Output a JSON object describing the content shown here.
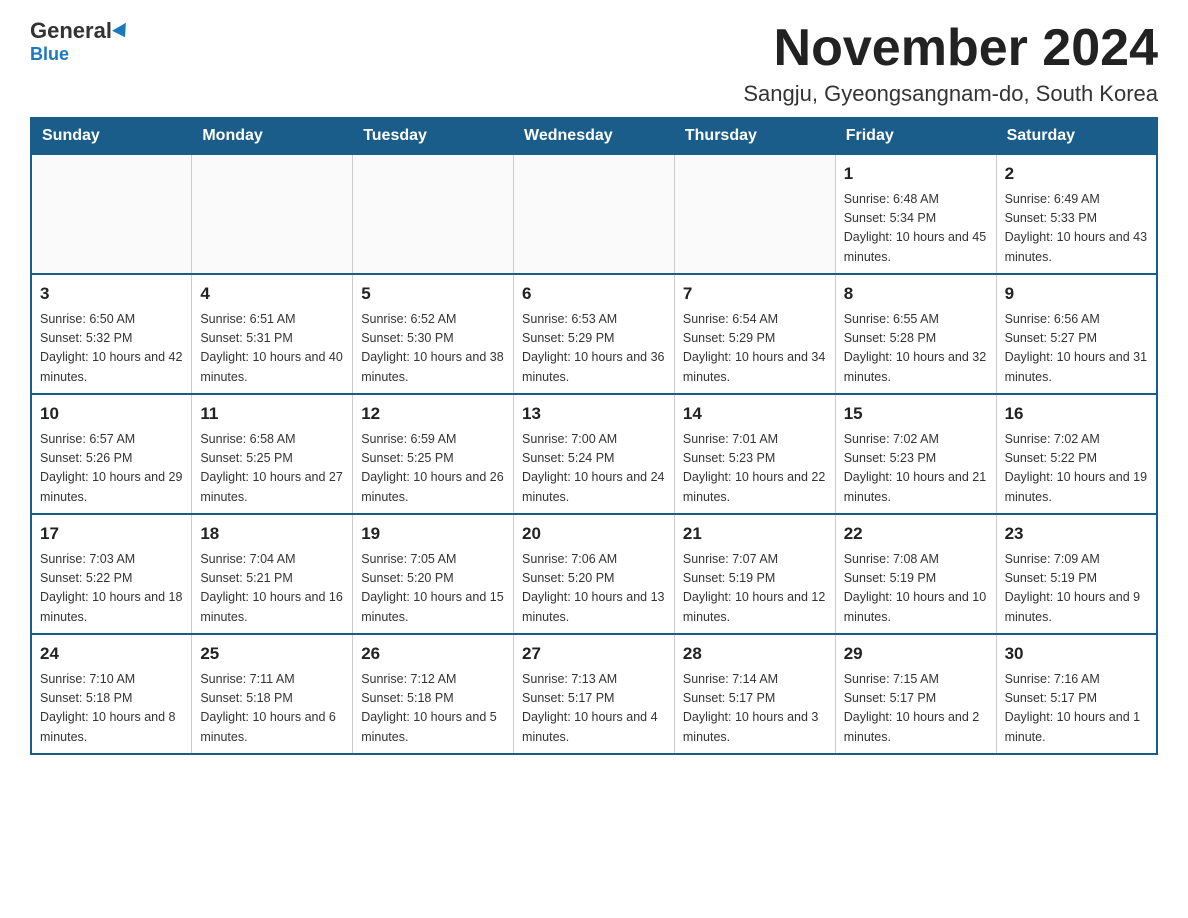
{
  "header": {
    "logo_general": "General",
    "logo_blue": "Blue",
    "month_title": "November 2024",
    "subtitle": "Sangju, Gyeongsangnam-do, South Korea"
  },
  "days_of_week": [
    "Sunday",
    "Monday",
    "Tuesday",
    "Wednesday",
    "Thursday",
    "Friday",
    "Saturday"
  ],
  "weeks": [
    [
      {
        "day": "",
        "info": ""
      },
      {
        "day": "",
        "info": ""
      },
      {
        "day": "",
        "info": ""
      },
      {
        "day": "",
        "info": ""
      },
      {
        "day": "",
        "info": ""
      },
      {
        "day": "1",
        "info": "Sunrise: 6:48 AM\nSunset: 5:34 PM\nDaylight: 10 hours and 45 minutes."
      },
      {
        "day": "2",
        "info": "Sunrise: 6:49 AM\nSunset: 5:33 PM\nDaylight: 10 hours and 43 minutes."
      }
    ],
    [
      {
        "day": "3",
        "info": "Sunrise: 6:50 AM\nSunset: 5:32 PM\nDaylight: 10 hours and 42 minutes."
      },
      {
        "day": "4",
        "info": "Sunrise: 6:51 AM\nSunset: 5:31 PM\nDaylight: 10 hours and 40 minutes."
      },
      {
        "day": "5",
        "info": "Sunrise: 6:52 AM\nSunset: 5:30 PM\nDaylight: 10 hours and 38 minutes."
      },
      {
        "day": "6",
        "info": "Sunrise: 6:53 AM\nSunset: 5:29 PM\nDaylight: 10 hours and 36 minutes."
      },
      {
        "day": "7",
        "info": "Sunrise: 6:54 AM\nSunset: 5:29 PM\nDaylight: 10 hours and 34 minutes."
      },
      {
        "day": "8",
        "info": "Sunrise: 6:55 AM\nSunset: 5:28 PM\nDaylight: 10 hours and 32 minutes."
      },
      {
        "day": "9",
        "info": "Sunrise: 6:56 AM\nSunset: 5:27 PM\nDaylight: 10 hours and 31 minutes."
      }
    ],
    [
      {
        "day": "10",
        "info": "Sunrise: 6:57 AM\nSunset: 5:26 PM\nDaylight: 10 hours and 29 minutes."
      },
      {
        "day": "11",
        "info": "Sunrise: 6:58 AM\nSunset: 5:25 PM\nDaylight: 10 hours and 27 minutes."
      },
      {
        "day": "12",
        "info": "Sunrise: 6:59 AM\nSunset: 5:25 PM\nDaylight: 10 hours and 26 minutes."
      },
      {
        "day": "13",
        "info": "Sunrise: 7:00 AM\nSunset: 5:24 PM\nDaylight: 10 hours and 24 minutes."
      },
      {
        "day": "14",
        "info": "Sunrise: 7:01 AM\nSunset: 5:23 PM\nDaylight: 10 hours and 22 minutes."
      },
      {
        "day": "15",
        "info": "Sunrise: 7:02 AM\nSunset: 5:23 PM\nDaylight: 10 hours and 21 minutes."
      },
      {
        "day": "16",
        "info": "Sunrise: 7:02 AM\nSunset: 5:22 PM\nDaylight: 10 hours and 19 minutes."
      }
    ],
    [
      {
        "day": "17",
        "info": "Sunrise: 7:03 AM\nSunset: 5:22 PM\nDaylight: 10 hours and 18 minutes."
      },
      {
        "day": "18",
        "info": "Sunrise: 7:04 AM\nSunset: 5:21 PM\nDaylight: 10 hours and 16 minutes."
      },
      {
        "day": "19",
        "info": "Sunrise: 7:05 AM\nSunset: 5:20 PM\nDaylight: 10 hours and 15 minutes."
      },
      {
        "day": "20",
        "info": "Sunrise: 7:06 AM\nSunset: 5:20 PM\nDaylight: 10 hours and 13 minutes."
      },
      {
        "day": "21",
        "info": "Sunrise: 7:07 AM\nSunset: 5:19 PM\nDaylight: 10 hours and 12 minutes."
      },
      {
        "day": "22",
        "info": "Sunrise: 7:08 AM\nSunset: 5:19 PM\nDaylight: 10 hours and 10 minutes."
      },
      {
        "day": "23",
        "info": "Sunrise: 7:09 AM\nSunset: 5:19 PM\nDaylight: 10 hours and 9 minutes."
      }
    ],
    [
      {
        "day": "24",
        "info": "Sunrise: 7:10 AM\nSunset: 5:18 PM\nDaylight: 10 hours and 8 minutes."
      },
      {
        "day": "25",
        "info": "Sunrise: 7:11 AM\nSunset: 5:18 PM\nDaylight: 10 hours and 6 minutes."
      },
      {
        "day": "26",
        "info": "Sunrise: 7:12 AM\nSunset: 5:18 PM\nDaylight: 10 hours and 5 minutes."
      },
      {
        "day": "27",
        "info": "Sunrise: 7:13 AM\nSunset: 5:17 PM\nDaylight: 10 hours and 4 minutes."
      },
      {
        "day": "28",
        "info": "Sunrise: 7:14 AM\nSunset: 5:17 PM\nDaylight: 10 hours and 3 minutes."
      },
      {
        "day": "29",
        "info": "Sunrise: 7:15 AM\nSunset: 5:17 PM\nDaylight: 10 hours and 2 minutes."
      },
      {
        "day": "30",
        "info": "Sunrise: 7:16 AM\nSunset: 5:17 PM\nDaylight: 10 hours and 1 minute."
      }
    ]
  ]
}
